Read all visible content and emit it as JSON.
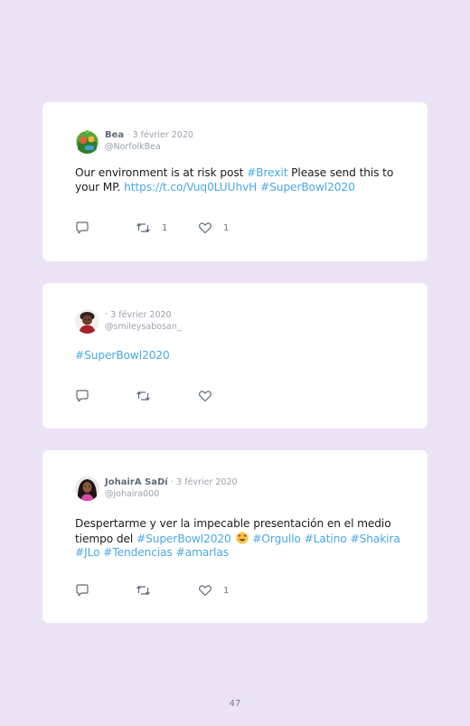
{
  "tweets": [
    {
      "author": "Bea",
      "separator": "·",
      "date": "3 février 2020",
      "handle": "@NorfolkBea",
      "text_tokens": [
        {
          "t": "Our environment is at risk post ",
          "link": false
        },
        {
          "t": "#Brexit",
          "link": true
        },
        {
          "t": " Please send this to your MP. ",
          "link": false
        },
        {
          "t": "https://t.co/Vuq0LUUhvH",
          "link": true
        },
        {
          "t": " ",
          "link": false
        },
        {
          "t": "#SuperBowl2020",
          "link": true
        }
      ],
      "retweets": "1",
      "likes": "1"
    },
    {
      "author": "",
      "separator": "·",
      "date": "3 février 2020",
      "handle": "@smileysabosan_",
      "text_tokens": [
        {
          "t": "#SuperBowl2020",
          "link": true
        }
      ],
      "retweets": "",
      "likes": ""
    },
    {
      "author": "JohairA SaDí",
      "separator": "·",
      "date": "3 février 2020",
      "handle": "@johaira000",
      "text_tokens": [
        {
          "t": "Despertarme y ver la impecable presentación en el medio tiempo del ",
          "link": false
        },
        {
          "t": "#SuperBowl2020",
          "link": true
        },
        {
          "t": " ",
          "link": false
        },
        {
          "emoji": "heart-eyes-emoji"
        },
        {
          "t": " ",
          "link": false
        },
        {
          "t": "#Orgullo",
          "link": true
        },
        {
          "t": " ",
          "link": false
        },
        {
          "t": "#Latino",
          "link": true
        },
        {
          "t": " ",
          "link": false
        },
        {
          "t": "#Shakira",
          "link": true
        },
        {
          "t": " ",
          "link": false
        },
        {
          "t": "#JLo",
          "link": true
        },
        {
          "t": " ",
          "link": false
        },
        {
          "t": "#Tendencias",
          "link": true
        },
        {
          "t": " ",
          "link": false
        },
        {
          "t": "#amarlas",
          "link": true
        }
      ],
      "retweets": "",
      "likes": "1"
    }
  ],
  "icons": {
    "reply": "reply-bubble-icon",
    "retweet": "retweet-icon",
    "like": "heart-icon"
  },
  "colors": {
    "background": "#ece4f6",
    "card": "#ffffff",
    "link": "#4aa8e6",
    "muted": "#9aa1aa"
  },
  "page_number": "47"
}
